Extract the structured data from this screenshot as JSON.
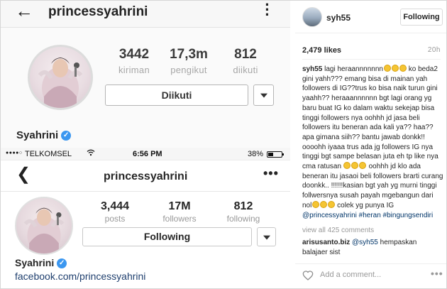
{
  "top_screenshot": {
    "username": "princessyahrini",
    "stats": [
      {
        "value": "3442",
        "label": "kiriman"
      },
      {
        "value": "17,3m",
        "label": "pengikut"
      },
      {
        "value": "812",
        "label": "diikuti"
      }
    ],
    "follow_button": "Diikuti",
    "display_name": "Syahrini"
  },
  "status_bar": {
    "signal": "●●●●○",
    "carrier": "TELKOMSEL",
    "time": "6:56 PM",
    "battery": "38%"
  },
  "bottom_screenshot": {
    "username": "princessyahrini",
    "more": "•••",
    "stats": [
      {
        "value": "3,444",
        "label": "posts"
      },
      {
        "value": "17M",
        "label": "followers"
      },
      {
        "value": "812",
        "label": "following"
      }
    ],
    "follow_button": "Following",
    "display_name": "Syahrini",
    "link": "facebook.com/princessyahrini"
  },
  "post": {
    "author": "syh55",
    "follow_button": "Following",
    "likes": "2,479 likes",
    "time": "20h",
    "caption_author": "syh55",
    "caption_lines": [
      "lagi heraannnnnnn",
      "ko beda2 gini yahh??? emang bisa di mainan yah followers di IG??trus ko bisa naik turun gini yaahh?? heraaannnnnn bgt lagi orang yg baru buat IG ko dalam waktu sekejap bisa tinggi followers nya oohhh jd jasa beli followers itu beneran ada kali ya?? haa?? apa gimana siih?? bantu jawab donkk!! oooohh iyaaa trus ada jg followers IG nya tinggi bgt sampe belasan juta eh tp like nya cma ratusan",
      "oohhh jd klo ada beneran itu jasaoi beli followers brarti curang doonkk.. !!!!!!kasian bgt yah yg murni tinggi follwersnya susah payah mgebangun dari nol",
      "colek yg punya IG"
    ],
    "caption_mention": "@princessyahrini",
    "caption_tags": "#heran #bingungsendiri",
    "view_all": "view all 425 comments",
    "comment_author": "arisusanto.biz",
    "comment_mention": "@syh55",
    "comment_text": "hempaskan balajaer sist",
    "add_comment_placeholder": "Add a comment...",
    "more": "•••"
  }
}
